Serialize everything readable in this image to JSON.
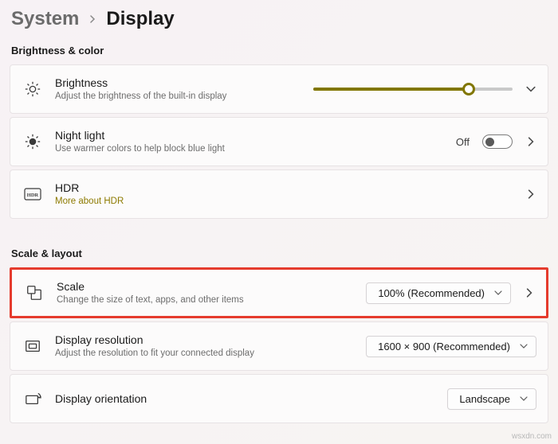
{
  "breadcrumb": {
    "parent": "System",
    "current": "Display"
  },
  "sections": {
    "brightness": "Brightness & color",
    "scale": "Scale & layout"
  },
  "brightness": {
    "title": "Brightness",
    "sub": "Adjust the brightness of the built-in display",
    "value_pct": 78
  },
  "nightlight": {
    "title": "Night light",
    "sub": "Use warmer colors to help block blue light",
    "status": "Off",
    "enabled": false
  },
  "hdr": {
    "title": "HDR",
    "link": "More about HDR"
  },
  "scale_row": {
    "title": "Scale",
    "sub": "Change the size of text, apps, and other items",
    "value": "100% (Recommended)"
  },
  "resolution": {
    "title": "Display resolution",
    "sub": "Adjust the resolution to fit your connected display",
    "value": "1600 × 900 (Recommended)"
  },
  "orientation": {
    "title": "Display orientation",
    "value": "Landscape"
  },
  "watermark": "wsxdn.com"
}
